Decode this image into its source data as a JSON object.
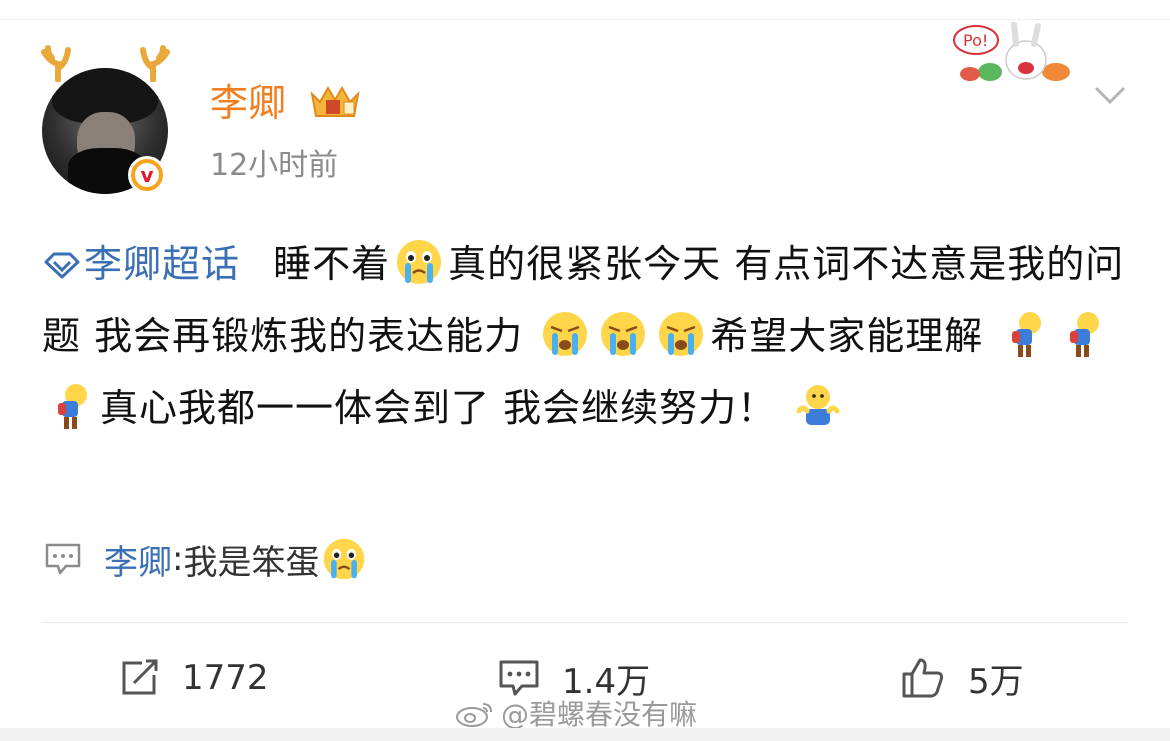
{
  "post": {
    "username": "李卿",
    "timestamp": "12小时前",
    "topic": "李卿超话",
    "text_parts": {
      "t1": "睡不着",
      "t2": "真的很紧张今天 有点词不达意是我的问题 我会再锻炼我的表达能力",
      "t3": "希望大家能理解",
      "t4": "真心我都一一体会到了 我会继续努力！"
    },
    "sticker_text": "Po!"
  },
  "repost": {
    "name": "李卿",
    "separator": ": ",
    "text": "我是笨蛋"
  },
  "actions": {
    "repost_count": "1772",
    "comment_count": "1.4万",
    "like_count": "5万"
  },
  "watermark": "@碧螺春没有嘛",
  "icons": [
    "verified-badge-icon",
    "crown-badge-icon",
    "chevron-down-icon",
    "super-topic-icon",
    "crying-emoji-icon",
    "sad-bow-emoji-icon",
    "shrug-emoji-icon",
    "repost-icon",
    "comment-icon",
    "like-icon",
    "weibo-logo-icon"
  ],
  "colors": {
    "username": "#f27e1f",
    "link": "#3a6fb6",
    "timestamp": "#8b8b8b",
    "verified": "#f7a31c"
  }
}
